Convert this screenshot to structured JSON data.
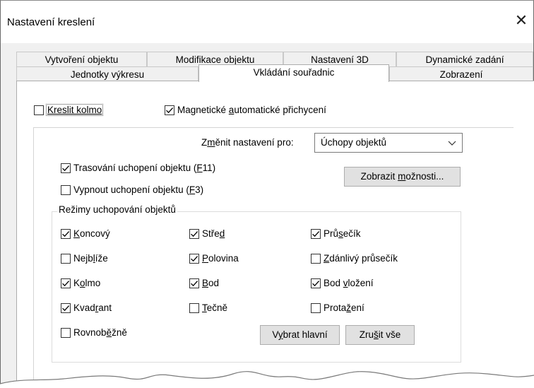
{
  "window": {
    "title": "Nastavení kreslení",
    "close_glyph": "✕"
  },
  "tabs_row1": [
    {
      "label": "Vytvoření objektu"
    },
    {
      "label": "Modifikace objektu"
    },
    {
      "label": "Nastavení 3D"
    },
    {
      "label": "Dynamické zadání"
    }
  ],
  "tabs_row2": [
    {
      "label": "Jednotky výkresu"
    },
    {
      "label": "Vkládání souřadnic",
      "active": true
    },
    {
      "label": "Zobrazení"
    }
  ],
  "top_options": {
    "ortho": {
      "label": "Kreslit kolmo",
      "checked": false
    },
    "magnet": {
      "label_pre": "Magnetické ",
      "label_u": "a",
      "label_post": "utomatické přichycení",
      "checked": true
    }
  },
  "change_settings": {
    "label_pre": "Z",
    "label_u": "m",
    "label_post": "ěnit nastavení pro:",
    "value": "Úchopy objektů"
  },
  "tracking": {
    "trace": {
      "label_pre": "Trasování uchopení objektu (",
      "label_u": "F",
      "label_post": "11)",
      "checked": true
    },
    "disable": {
      "label_pre": "Vypnout uchopení objektu (",
      "label_u": "F",
      "label_post": "3)",
      "checked": false
    }
  },
  "show_options_button": {
    "label_pre": "Zobrazit ",
    "label_u": "m",
    "label_post": "ožnosti..."
  },
  "snap_modes": {
    "group_label": "Režimy uchopování objektů",
    "items": {
      "koncovy": {
        "u": "K",
        "rest": "oncový",
        "pre": "",
        "checked": true
      },
      "stred": {
        "pre": "Stře",
        "u": "d",
        "rest": "",
        "checked": true
      },
      "prusecik": {
        "pre": "Prů",
        "u": "s",
        "rest": "ečík",
        "checked": true
      },
      "nejblize": {
        "pre": "Nejb",
        "u": "l",
        "rest": "íže",
        "checked": false
      },
      "polovina": {
        "pre": "",
        "u": "P",
        "rest": "olovina",
        "checked": true
      },
      "zdanlivy": {
        "pre": "",
        "u": "Z",
        "rest": "dánlivý průsečík",
        "checked": false
      },
      "kolmo": {
        "pre": "K",
        "u": "o",
        "rest": "lmo",
        "checked": true
      },
      "bod": {
        "pre": "",
        "u": "B",
        "rest": "od",
        "checked": true
      },
      "bod_vlozeni": {
        "pre": "Bod ",
        "u": "v",
        "rest": "ložení",
        "checked": true
      },
      "kvadrant": {
        "pre": "Kvad",
        "u": "r",
        "rest": "ant",
        "checked": true
      },
      "tecne": {
        "pre": "",
        "u": "T",
        "rest": "ečně",
        "checked": false
      },
      "protazeni": {
        "pre": "Prota",
        "u": "ž",
        "rest": "ení",
        "checked": false
      },
      "rovnobezne": {
        "pre": "Rovnob",
        "u": "ě",
        "rest": "žně",
        "checked": false
      }
    }
  },
  "select_all_button": {
    "pre": "V",
    "u": "y",
    "rest": "brat hlavní"
  },
  "clear_all_button": {
    "pre": "Zru",
    "u": "š",
    "rest": "it vše"
  },
  "icons": {
    "check": "checkmark-icon",
    "chevron": "chevron-down-icon",
    "close": "close-icon"
  }
}
